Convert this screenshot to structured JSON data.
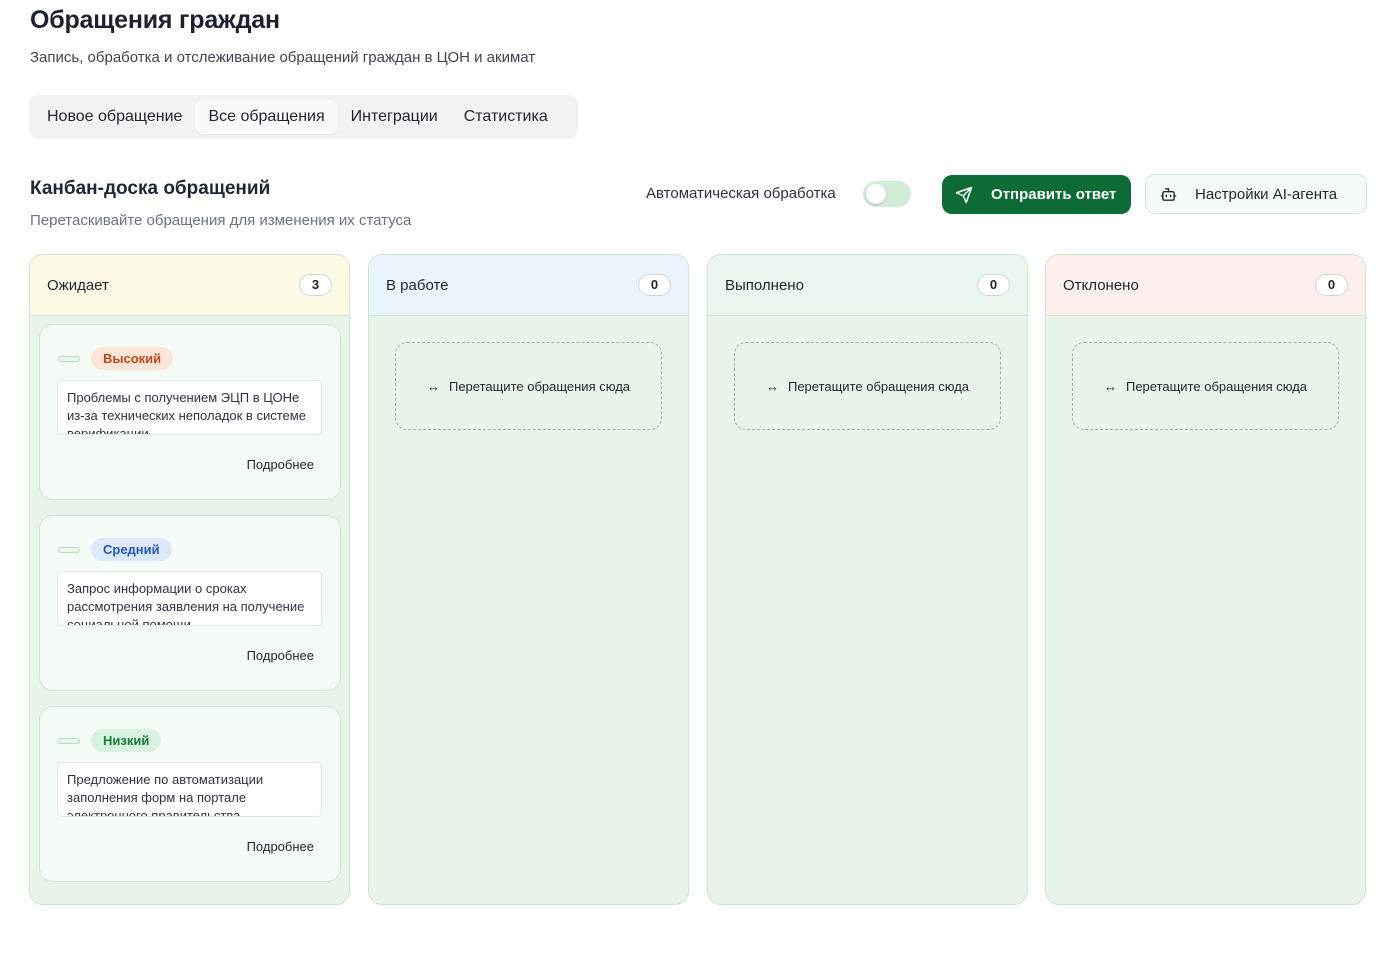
{
  "header": {
    "title": "Обращения граждан",
    "subtitle": "Запись, обработка и отслеживание обращений граждан в ЦОН и акимат"
  },
  "tabs": [
    {
      "label": "Новое обращение",
      "active": false
    },
    {
      "label": "Все обращения",
      "active": true
    },
    {
      "label": "Интеграции",
      "active": false
    },
    {
      "label": "Статистика",
      "active": false
    }
  ],
  "board": {
    "title": "Канбан-доска обращений",
    "subtitle": "Перетаскивайте обращения для изменения их статуса",
    "auto_label": "Автоматическая обработка",
    "auto_enabled": false,
    "send_label": "Отправить ответ",
    "ai_label": "Настройки AI-агента",
    "send_icon": "send-icon",
    "ai_icon": "bot-icon",
    "accent": "#0d6b35"
  },
  "columns": [
    {
      "name": "Ожидает",
      "count": "3",
      "cards": [
        {
          "priority": "Высокий",
          "text": "Проблемы с получением ЭЦП в ЦОНе из-за технических неполадок в системе верификации",
          "more": "Подробнее"
        },
        {
          "priority": "Средний",
          "text": "Запрос информации о сроках рассмотрения заявления на получение социальной помощи",
          "more": "Подробнее"
        },
        {
          "priority": "Низкий",
          "text": "Предложение по автоматизации заполнения форм на портале электронного правительства",
          "more": "Подробнее"
        }
      ]
    },
    {
      "name": "В работе",
      "count": "0",
      "drop_text": "Перетащите обращения сюда"
    },
    {
      "name": "Выполнено",
      "count": "0",
      "drop_text": "Перетащите обращения сюда"
    },
    {
      "name": "Отклонено",
      "count": "0",
      "drop_text": "Перетащите обращения сюда"
    }
  ]
}
